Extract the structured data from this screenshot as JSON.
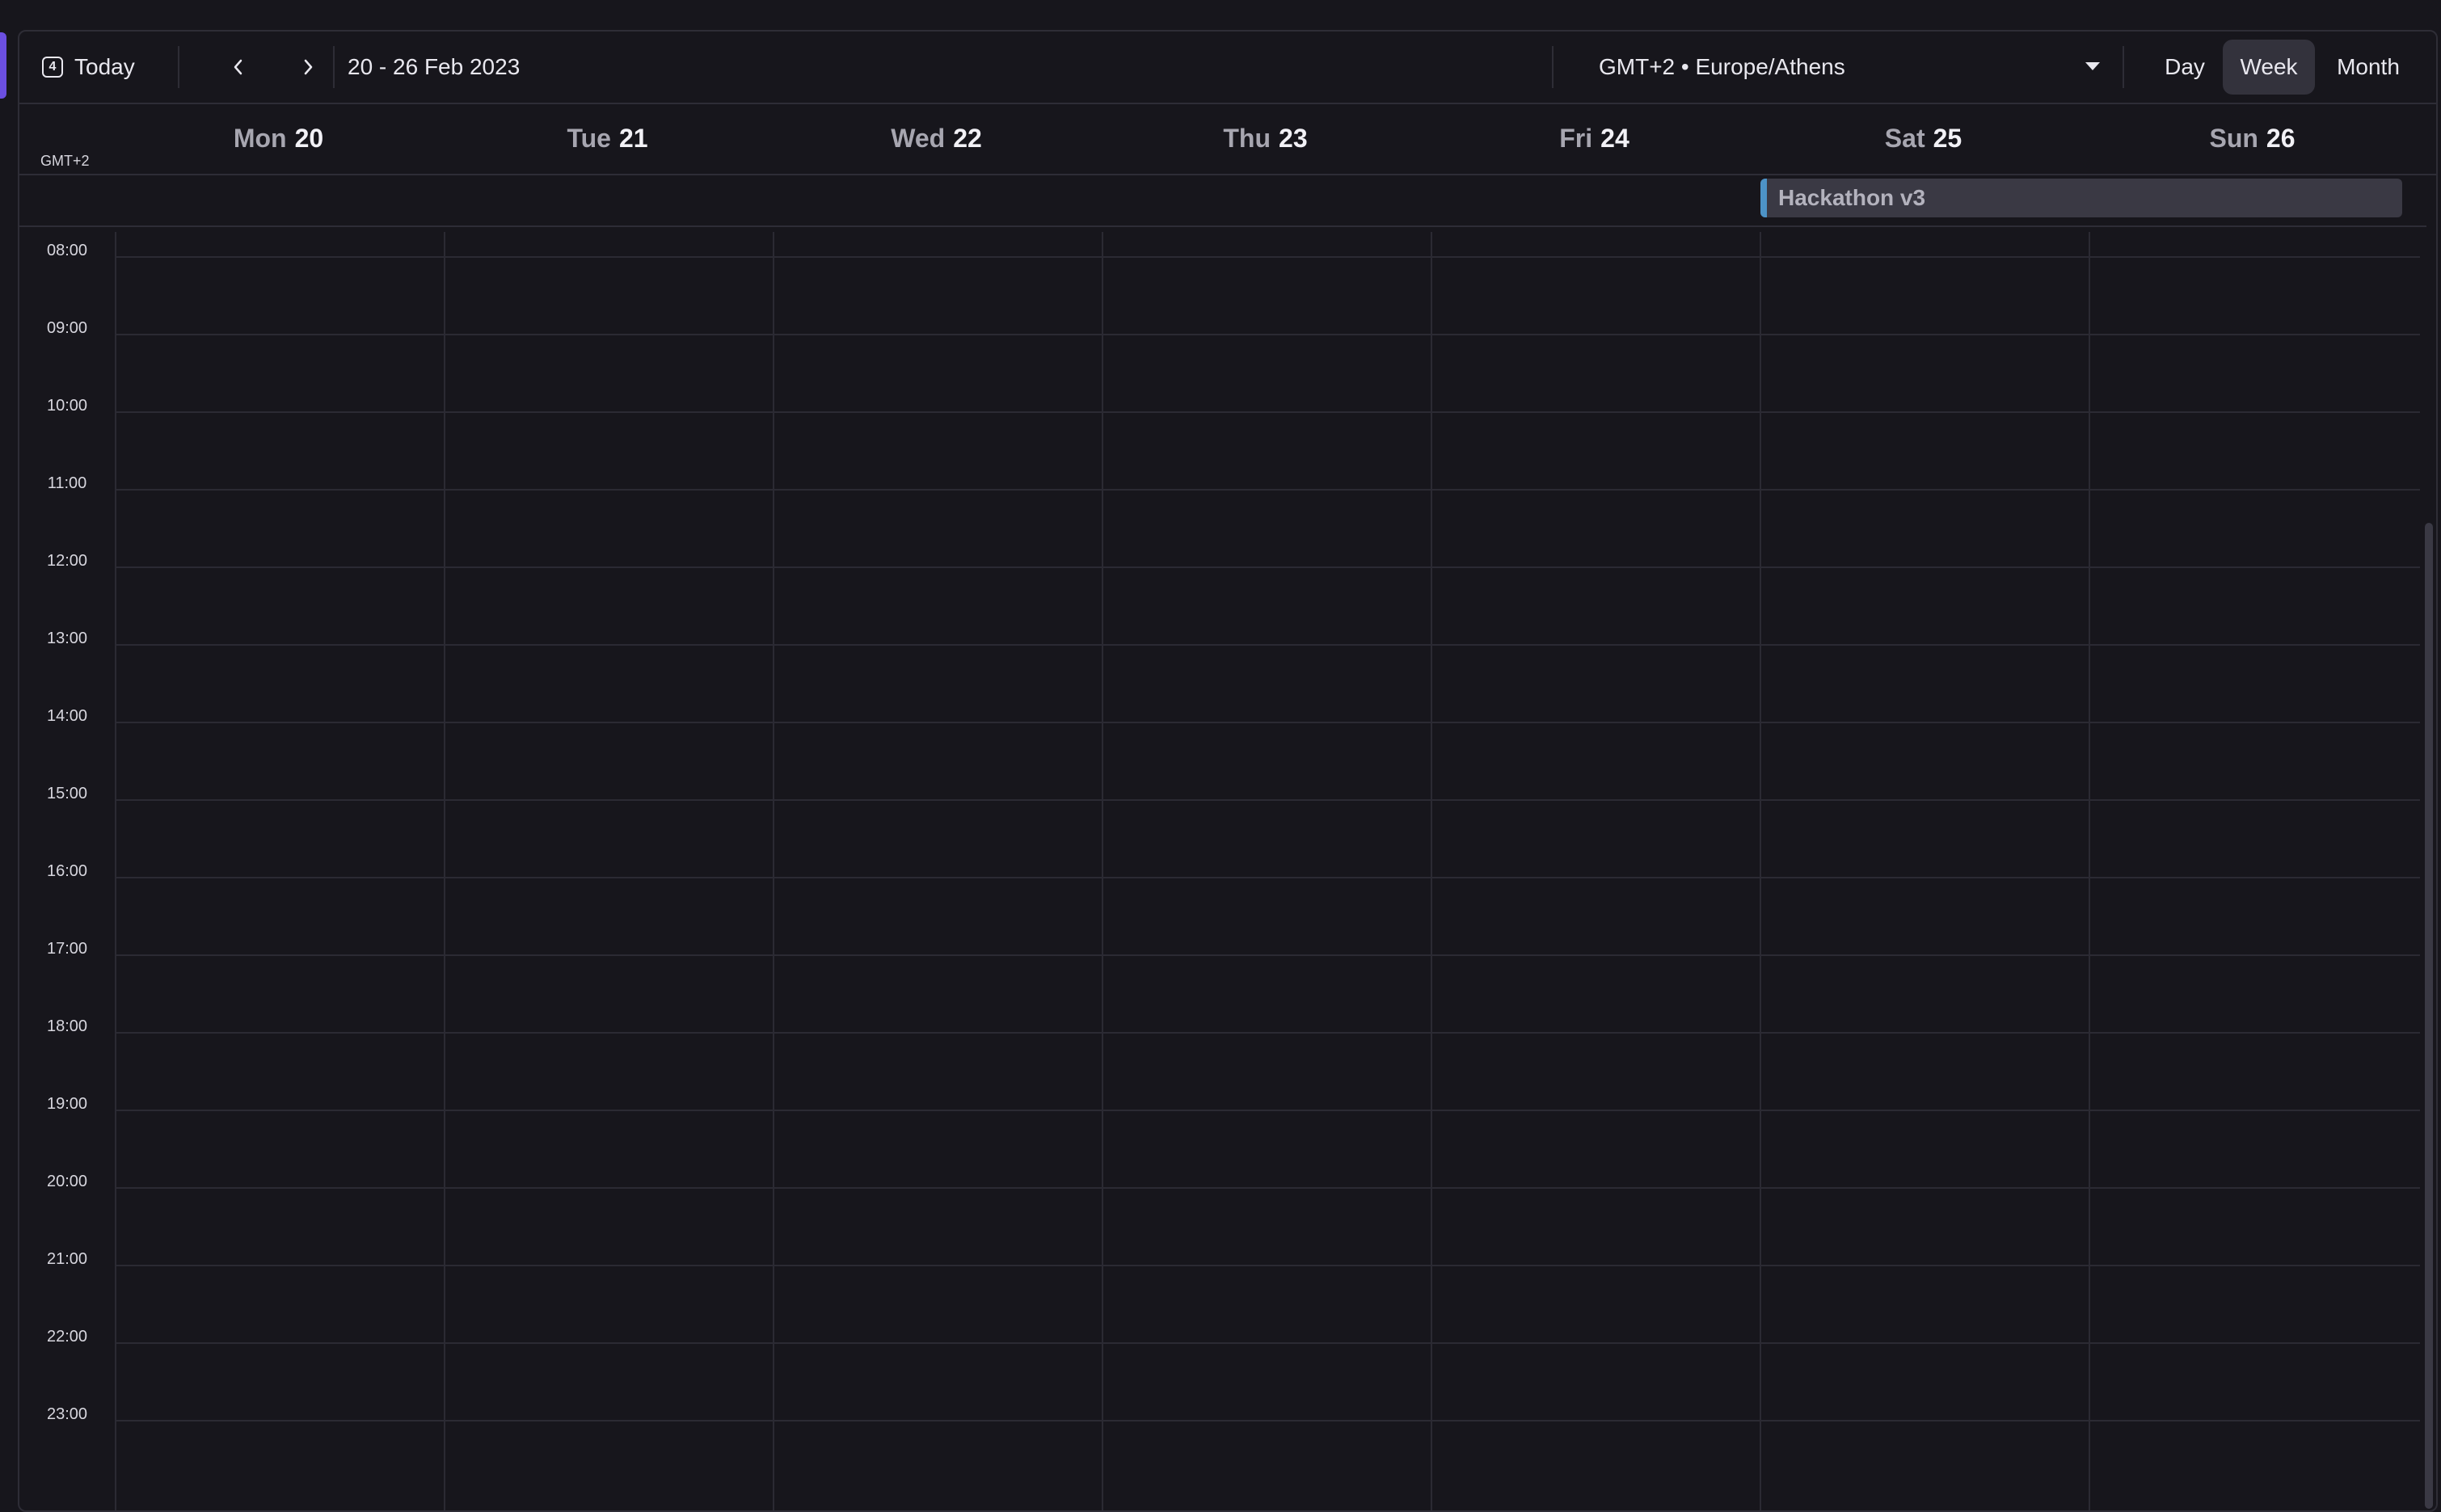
{
  "toolbar": {
    "today_icon_number": "4",
    "today_label": "Today",
    "prev_icon": "chevron-left-icon",
    "next_icon": "chevron-right-icon",
    "date_range": "20 - 26 Feb 2023",
    "timezone": "GMT+2 • Europe/Athens",
    "views": {
      "day": "Day",
      "week": "Week",
      "month": "Month",
      "active": "Week"
    }
  },
  "header": {
    "gmt_label": "GMT+2",
    "days": [
      {
        "name": "Mon",
        "num": "20"
      },
      {
        "name": "Tue",
        "num": "21"
      },
      {
        "name": "Wed",
        "num": "22"
      },
      {
        "name": "Thu",
        "num": "23"
      },
      {
        "name": "Fri",
        "num": "24"
      },
      {
        "name": "Sat",
        "num": "25"
      },
      {
        "name": "Sun",
        "num": "26"
      }
    ]
  },
  "all_day_events": [
    {
      "title": "Hackathon v3",
      "start_day": "Sat 25",
      "end_day": "Sun 26",
      "color": "#4d93c7"
    }
  ],
  "hours": [
    "08:00",
    "09:00",
    "10:00",
    "11:00",
    "12:00",
    "13:00",
    "14:00",
    "15:00",
    "16:00",
    "17:00",
    "18:00",
    "19:00",
    "20:00",
    "21:00",
    "22:00",
    "23:00"
  ],
  "colors": {
    "background": "#17161c",
    "accent": "#6b4fe0",
    "border": "#2e2d36",
    "event_bg": "#3a3944"
  }
}
